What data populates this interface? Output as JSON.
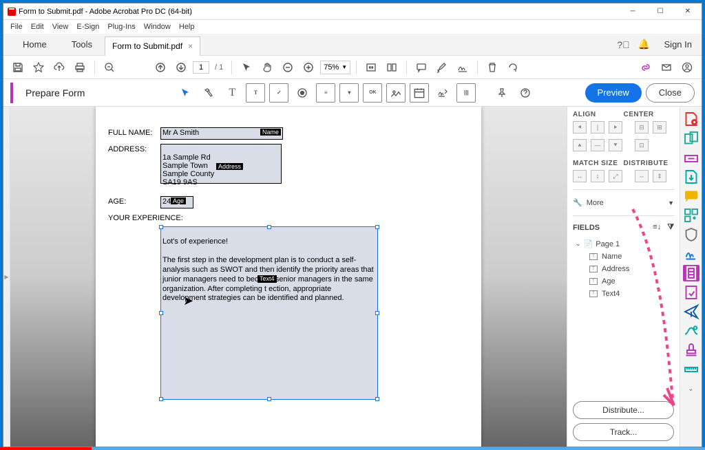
{
  "window": {
    "title": "Form to Submit.pdf - Adobe Acrobat Pro DC (64-bit)"
  },
  "menu": {
    "file": "File",
    "edit": "Edit",
    "view": "View",
    "esign": "E-Sign",
    "plugins": "Plug-Ins",
    "window": "Window",
    "help": "Help"
  },
  "tabs": {
    "home": "Home",
    "tools": "Tools",
    "doc": "Form to Submit.pdf"
  },
  "signin": "Sign In",
  "toolbar": {
    "page_current": "1",
    "page_total": "/  1",
    "zoom": "75%"
  },
  "prepare": {
    "label": "Prepare Form",
    "preview": "Preview",
    "close": "Close"
  },
  "form": {
    "fullname_label": "FULL NAME:",
    "fullname_value": "Mr A Smith",
    "fullname_tag": "Name",
    "address_label": "ADDRESS:",
    "address_value": "1a Sample Rd\nSample Town\nSample County\nSA19 9AS",
    "address_tag": "Address",
    "age_label": "AGE:",
    "age_value": "24",
    "age_tag": "Age",
    "exp_label": "YOUR EXPERIENCE:",
    "exp_value": "Lot's of experience!\n\nThe first step in the development plan is to conduct a self-analysis such as SWOT and then identify the priority areas that junior managers need to become senior managers in the same organization. After completing t          ection, appropriate development strategies can be identified and planned.",
    "exp_tag": "Text4"
  },
  "rightpane": {
    "align": "ALIGN",
    "center": "CENTER",
    "matchsize": "MATCH SIZE",
    "distribute": "DISTRIBUTE",
    "more": "More",
    "fields": "FIELDS",
    "page": "Page 1",
    "field_items": [
      "Name",
      "Address",
      "Age",
      "Text4"
    ],
    "distribute_btn": "Distribute...",
    "track_btn": "Track..."
  }
}
